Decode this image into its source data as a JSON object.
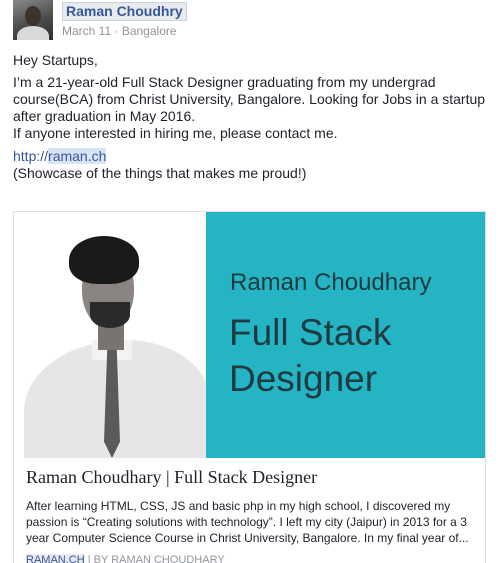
{
  "post": {
    "author": "Raman Choudhry",
    "date": "March 11",
    "separator": "·",
    "location": "Bangalore",
    "greeting": "Hey Startups,",
    "paragraph": "I’m a 21-year-old Full Stack Designer graduating from my undergrad course(BCA) from Christ University, Bangalore. Looking for Jobs in a startup after graduation in May 2016.",
    "line2": "If anyone interested in hiring me, please contact me.",
    "link_prefix": "http://",
    "link_domain": "raman.ch",
    "showcase": "(Showcase of the things that makes me proud!)"
  },
  "card": {
    "image_name": "Raman Choudhary",
    "image_role": "Full Stack Designer",
    "title": "Raman Choudhary | Full Stack Designer",
    "description": "After learning HTML, CSS, JS and basic php in my high school, I discovered my passion is “Creating solutions with technology”. I left my city (Jaipur) in 2013 for a 3 year Computer Science Course in Christ University, Bangalore. In my final year of...",
    "domain": "RAMAN.CH",
    "divider": "|",
    "byline": "BY RAMAN CHOUDHARY"
  },
  "colors": {
    "link": "#365899",
    "teal_banner": "#25b4c4",
    "muted_text": "#90949c"
  },
  "icons": {
    "avatar": "profile-photo"
  }
}
